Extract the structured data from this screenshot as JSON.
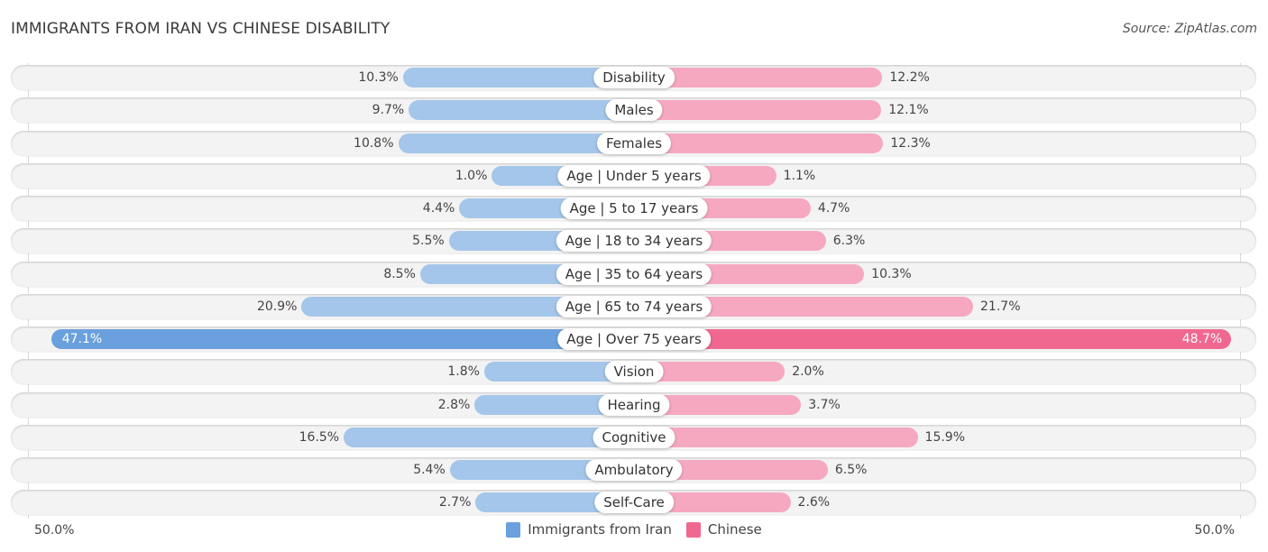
{
  "header": {
    "title": "IMMIGRANTS FROM IRAN VS CHINESE DISABILITY",
    "source": "Source: ZipAtlas.com"
  },
  "colors": {
    "left_light": "#a4c6ea",
    "left_dark": "#6aa0dd",
    "right_light": "#f6a8c1",
    "right_dark": "#f06890"
  },
  "chart_data": {
    "type": "bar",
    "orientation": "horizontal-diverging",
    "title": "IMMIGRANTS FROM IRAN VS CHINESE DISABILITY",
    "categories": [
      "Disability",
      "Males",
      "Females",
      "Age | Under 5 years",
      "Age | 5 to 17 years",
      "Age | 18 to 34 years",
      "Age | 35 to 64 years",
      "Age | 65 to 74 years",
      "Age | Over 75 years",
      "Vision",
      "Hearing",
      "Cognitive",
      "Ambulatory",
      "Self-Care"
    ],
    "series": [
      {
        "name": "Immigrants from Iran",
        "side": "left",
        "values": [
          10.3,
          9.7,
          10.8,
          1.0,
          4.4,
          5.5,
          8.5,
          20.9,
          47.1,
          1.8,
          2.8,
          16.5,
          5.4,
          2.7
        ],
        "labels": [
          "10.3%",
          "9.7%",
          "10.8%",
          "1.0%",
          "4.4%",
          "5.5%",
          "8.5%",
          "20.9%",
          "47.1%",
          "1.8%",
          "2.8%",
          "16.5%",
          "5.4%",
          "2.7%"
        ]
      },
      {
        "name": "Chinese",
        "side": "right",
        "values": [
          12.2,
          12.1,
          12.3,
          1.1,
          4.7,
          6.3,
          10.3,
          21.7,
          48.7,
          2.0,
          3.7,
          15.9,
          6.5,
          2.6
        ],
        "labels": [
          "12.2%",
          "12.1%",
          "12.3%",
          "1.1%",
          "4.7%",
          "6.3%",
          "10.3%",
          "21.7%",
          "48.7%",
          "2.0%",
          "3.7%",
          "15.9%",
          "6.5%",
          "2.6%"
        ]
      }
    ],
    "xlim": [
      -50,
      50
    ],
    "axis_left_label": "50.0%",
    "axis_right_label": "50.0%",
    "legend": [
      "Immigrants from Iran",
      "Chinese"
    ],
    "legend_position": "bottom-center",
    "grid": false
  }
}
